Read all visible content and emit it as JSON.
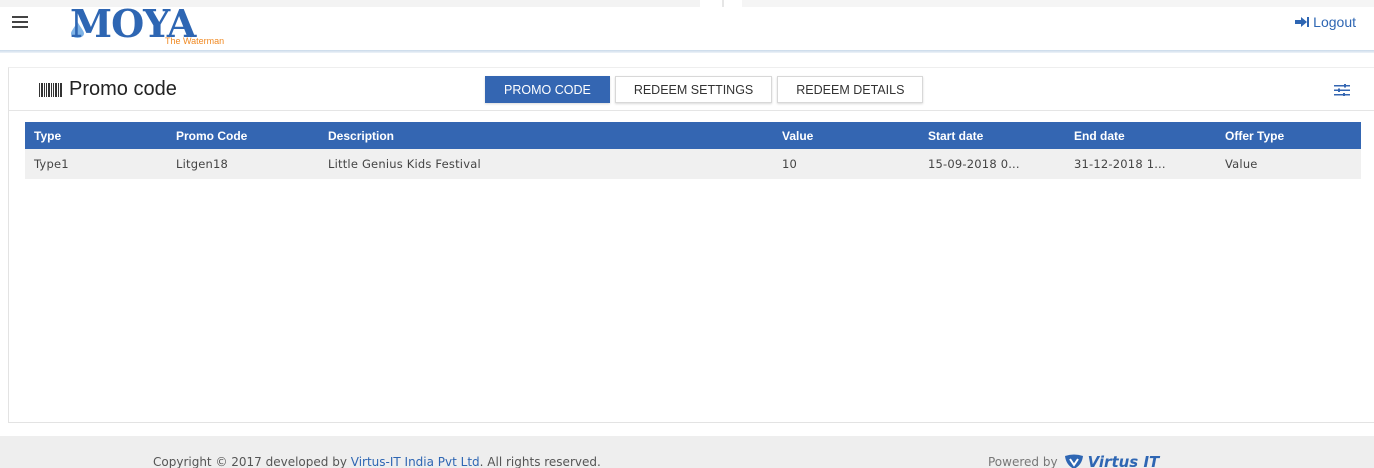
{
  "header": {
    "logo_text": "MOYA",
    "logo_tagline": "The Waterman",
    "logout_label": "Logout"
  },
  "page": {
    "title": "Promo code"
  },
  "tabs": [
    {
      "label": "PROMO CODE",
      "active": true
    },
    {
      "label": "REDEEM SETTINGS",
      "active": false
    },
    {
      "label": "REDEEM DETAILS",
      "active": false
    }
  ],
  "table": {
    "columns": [
      "Type",
      "Promo Code",
      "Description",
      "Value",
      "Start date",
      "End date",
      "Offer Type"
    ],
    "rows": [
      [
        "Type1",
        "Litgen18",
        "Little Genius Kids Festival",
        "10",
        "15-09-2018 0...",
        "31-12-2018 1...",
        "Value"
      ]
    ]
  },
  "footer": {
    "copyright_prefix": "Copyright © 2017 developed by ",
    "company_link": "Virtus-IT India Pvt Ltd",
    "copyright_suffix": ". All rights reserved.",
    "powered_by": "Powered by",
    "powered_brand": "Virtus IT"
  },
  "colors": {
    "primary": "#3466b2",
    "logo_orange": "#f08a24"
  }
}
